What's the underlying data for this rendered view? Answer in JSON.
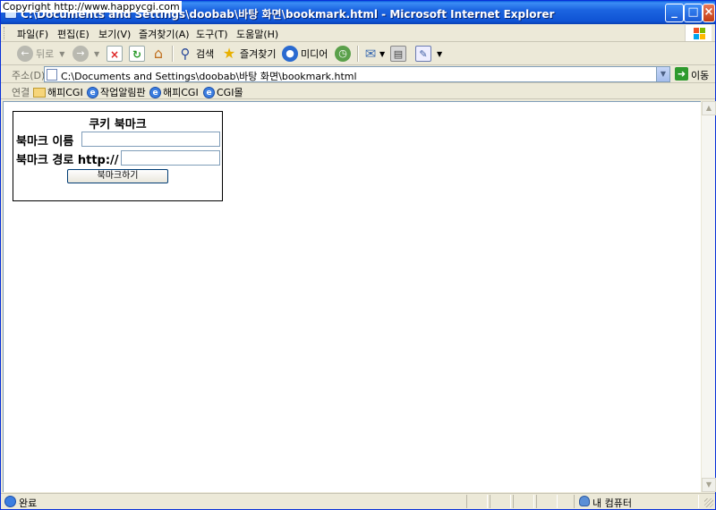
{
  "window": {
    "title": "C:\\Documents and Settings\\doobab\\바탕 화면\\bookmark.html - Microsoft Internet Explorer",
    "copyright": "Copyright   http://www.happycgi.com"
  },
  "menubar": {
    "items": [
      "파일(F)",
      "편집(E)",
      "보기(V)",
      "즐겨찾기(A)",
      "도구(T)",
      "도움말(H)"
    ]
  },
  "toolbar": {
    "back": "뒤로",
    "search": "검색",
    "favorites": "즐겨찾기",
    "media": "미디어"
  },
  "address": {
    "label": "주소(D)",
    "value": "C:\\Documents and Settings\\doobab\\바탕 화면\\bookmark.html",
    "go": "이동"
  },
  "links": {
    "label": "연결",
    "items": [
      "해피CGI",
      "작업알림판",
      "해피CGI",
      "CGI몰"
    ]
  },
  "bookmark": {
    "title": "쿠키 북마크",
    "name_label": "북마크 이름",
    "name_value": "",
    "path_label": "북마크 경로 http://",
    "path_value": "",
    "submit": "북마크하기"
  },
  "statusbar": {
    "status": "완료",
    "zone": "내 컴퓨터"
  },
  "colors": {
    "titlebar": "#0f53d4",
    "chrome": "#ece9d8",
    "input_border": "#7f9db9"
  }
}
